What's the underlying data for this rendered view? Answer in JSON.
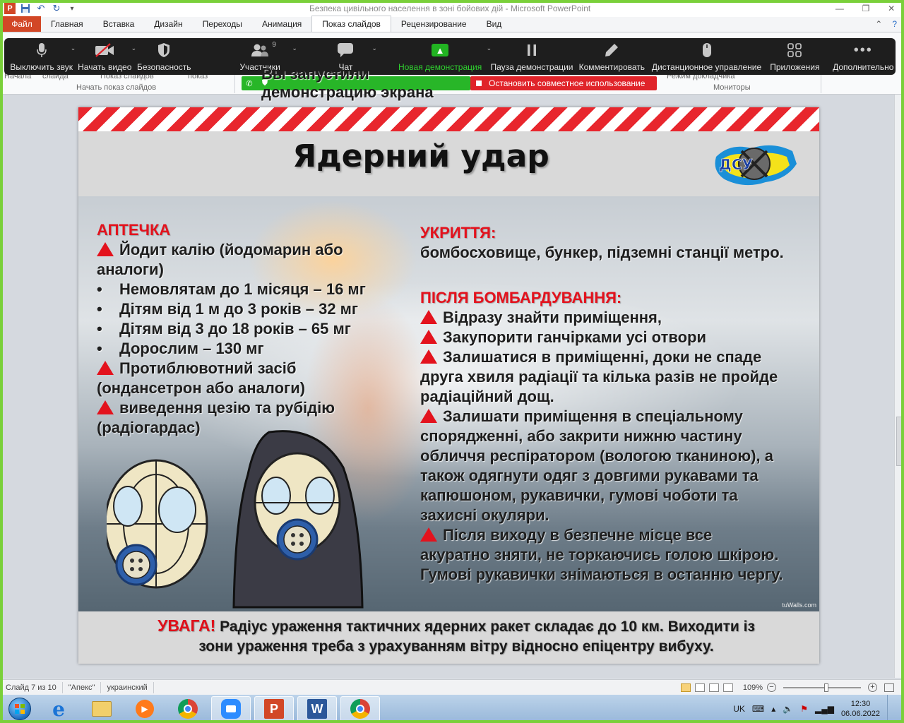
{
  "window": {
    "title": "Безпека цивільного населення в зоні бойових дій - Microsoft PowerPoint",
    "app_icon": "P",
    "controls": [
      "—",
      "❐",
      "✕"
    ]
  },
  "ribbon": {
    "file_tab": "Файл",
    "tabs": [
      "Главная",
      "Вставка",
      "Дизайн",
      "Переходы",
      "Анимация",
      "Показ слайдов",
      "Рецензирование",
      "Вид"
    ],
    "active_tab": "Показ слайдов",
    "fragments": [
      "Начала",
      "слайда",
      "Показ слайдов",
      "показ"
    ],
    "group_start": "Начать показ слайдов",
    "group_monitors": "Мониторы",
    "fragment_right": "Режим докладчика"
  },
  "zoom_toolbar": {
    "mute": "Выключить звук",
    "video": "Начать видео",
    "security": "Безопасность",
    "participants": "Участники",
    "participants_count": "9",
    "chat": "Чат",
    "new_share": "Новая демонстрация",
    "pause_share": "Пауза демонстрации",
    "annotate": "Комментировать",
    "remote_control": "Дистанционное управление",
    "apps": "Приложения",
    "more": "Дополнительно"
  },
  "share_status": {
    "sharing_text": "Вы запустили демонстрацию экрана",
    "stop_text": "Остановить совместное использование"
  },
  "slide": {
    "title": "Ядерний удар",
    "logo_text": "ДСУ",
    "left": {
      "heading": "АПТЕЧКА",
      "item1_line1": "Йодит калію (йодомарин або",
      "item1_line2": "аналоги)",
      "bullets": [
        "Немовлятам до 1 місяця – 16 мг",
        "Дітям від 1 м до 3 років – 32 мг",
        "Дітям від 3 до 18 років – 65 мг",
        "Дорослим – 130 мг"
      ],
      "item2_line1": "Протиблювотний засіб",
      "item2_line2": "(ондансетрон або аналоги)",
      "item3_line1": "виведення цезію та рубідію",
      "item3_line2": "(радіогардас)"
    },
    "right": {
      "shelter_heading": "УКРИТТЯ:",
      "shelter_text": "бомбосховище, бункер, підземні станції метро.",
      "after_heading": "ПІСЛЯ БОМБАРДУВАННЯ:",
      "lines": [
        {
          "tri": true,
          "text": "Відразу знайти приміщення,"
        },
        {
          "tri": true,
          "text": "Закупорити ганчірками усі отвори"
        },
        {
          "tri": true,
          "text": "Залишатися в приміщенні, доки не спаде"
        },
        {
          "tri": false,
          "text": "друга хвиля радіації та кілька разів не пройде"
        },
        {
          "tri": false,
          "text": "радіаційний дощ."
        },
        {
          "tri": true,
          "text": "Залишати приміщення в спеціальному"
        },
        {
          "tri": false,
          "text": "спорядженні, або  закрити нижню частину"
        },
        {
          "tri": false,
          "text": "обличчя респіратором (вологою тканиною), а"
        },
        {
          "tri": false,
          "text": "також одягнути одяг з довгими рукавами та"
        },
        {
          "tri": false,
          "text": "капюшоном, рукавички, гумові чоботи та"
        },
        {
          "tri": false,
          "text": "захисні окуляри."
        },
        {
          "tri": true,
          "text": "Після виходу в безпечне місце все"
        },
        {
          "tri": false,
          "text": "акуратно зняти, не торкаючись голою шкірою."
        },
        {
          "tri": false,
          "text": "Гумові рукавички знімаються в останню чергу."
        }
      ]
    },
    "photo_credit": "tuWalls.com",
    "warning_label": "УВАГА!",
    "warning_line1": " Радіус ураження тактичних ядерних ракет складає до 10 км. Виходити із",
    "warning_line2": "зони ураження треба з урахуванням вітру відносно епіцентру вибуху."
  },
  "status": {
    "slide_info": "Слайд 7 из 10",
    "theme": "\"Апекс\"",
    "language": "украинский",
    "zoom": "109%",
    "zoom_fraction": 0.55
  },
  "taskbar": {
    "lang": "UK",
    "time": "12:30",
    "date": "06.06.2022"
  }
}
